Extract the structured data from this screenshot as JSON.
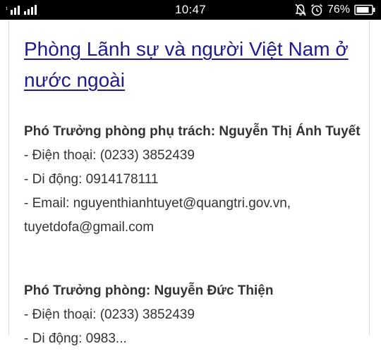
{
  "status_bar": {
    "signal_label": "¹",
    "time": "10:47",
    "battery_percent": "76%"
  },
  "article": {
    "heading": "Phòng Lãnh sự và người Việt Nam ở nước ngoài",
    "contacts": [
      {
        "role_name": "Phó Trưởng phòng phụ trách: Nguyễn Thị Ánh Tuyết",
        "phone": "- Điện thoại: (0233) 3852439",
        "mobile": "- Di động: 0914178111",
        "email_line1": "- Email: nguyenthianhtuyet@quangtri.gov.vn,",
        "email_line2": "tuyetdofa@gmail.com"
      },
      {
        "role_name": "Phó Trưởng phòng: Nguyễn Đức Thiện",
        "phone": "- Điện thoại: (0233) 3852439",
        "mobile_partial": "- Di động: 0983..."
      }
    ]
  }
}
